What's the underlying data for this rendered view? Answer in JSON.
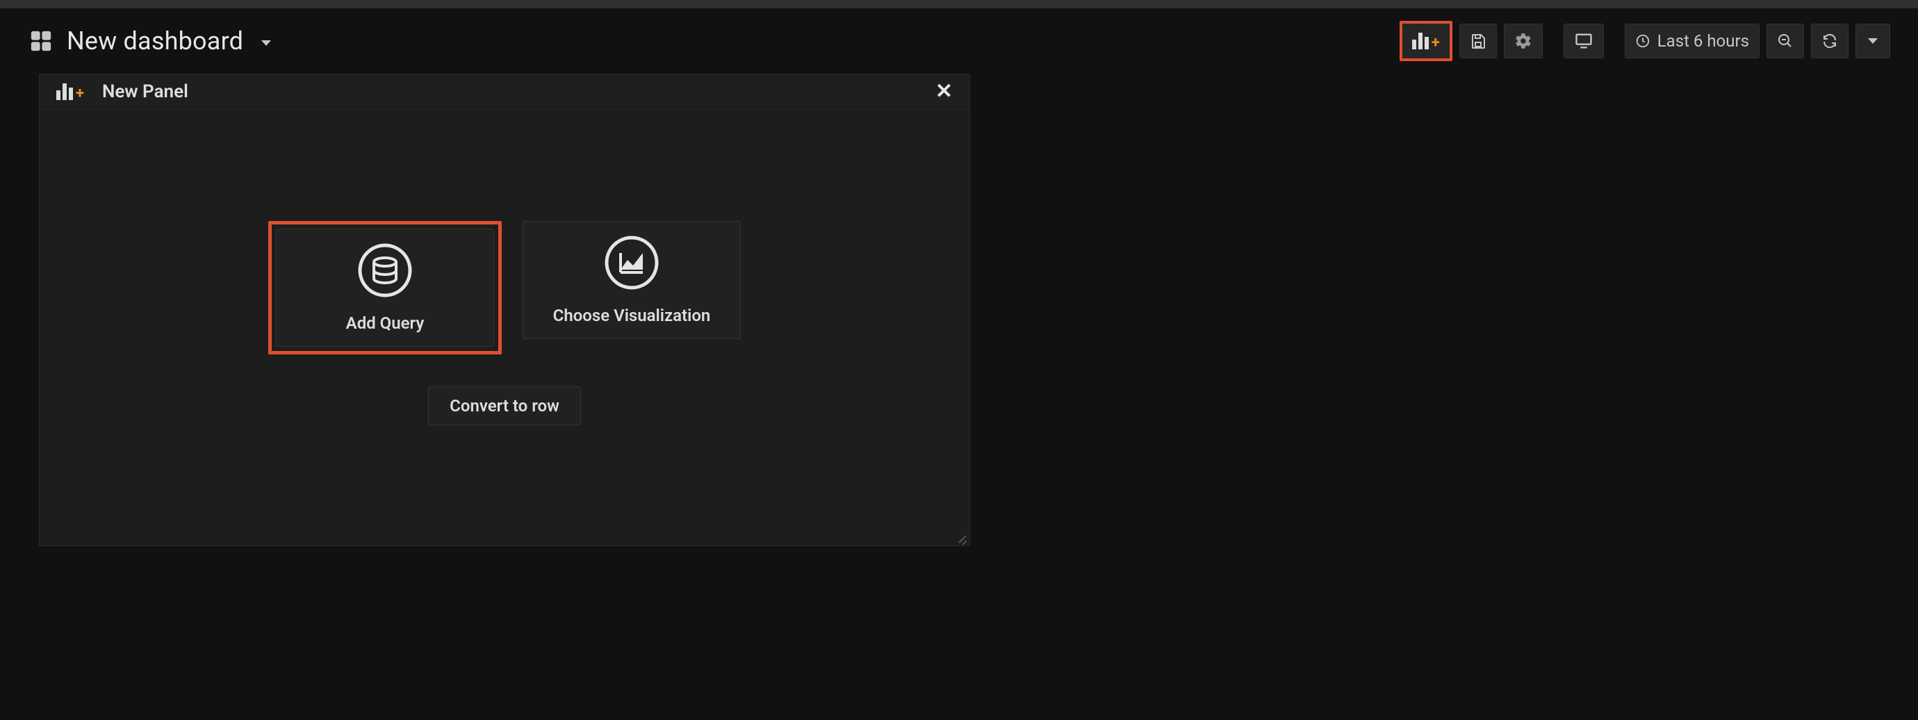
{
  "header": {
    "title": "New dashboard",
    "time_range": "Last 6 hours"
  },
  "panel": {
    "title": "New Panel",
    "add_query": "Add Query",
    "choose_viz": "Choose Visualization",
    "convert_row": "Convert to row"
  }
}
